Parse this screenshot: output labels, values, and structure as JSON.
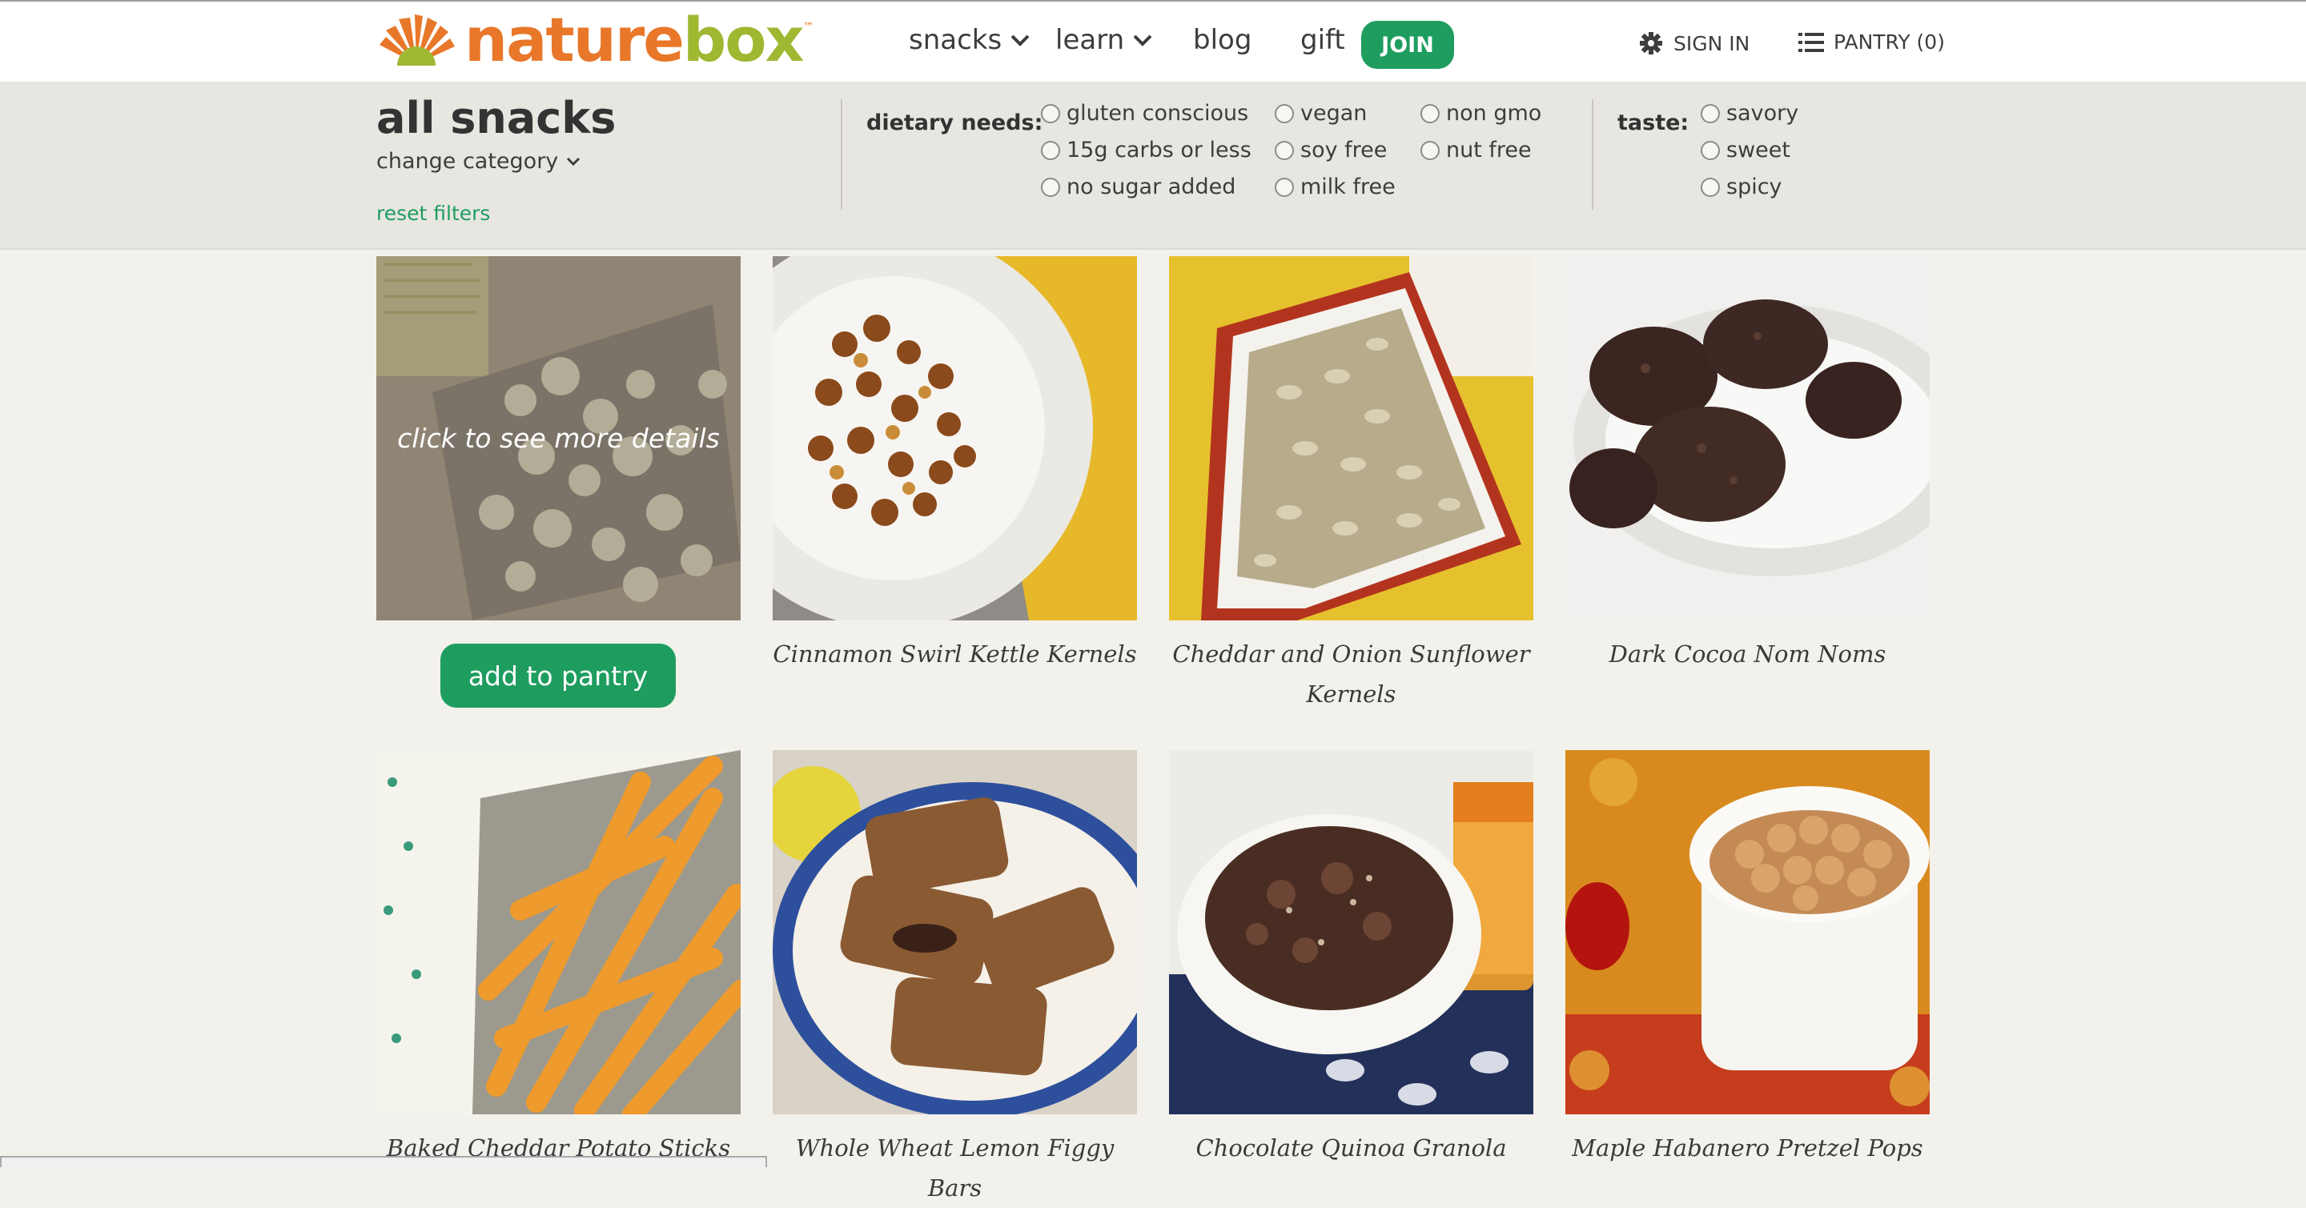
{
  "brand": {
    "word1": "nature",
    "word2": "box",
    "tm": "™"
  },
  "nav": {
    "snacks": "snacks",
    "learn": "learn",
    "blog": "blog",
    "gift": "gift",
    "join": "JOIN",
    "signin": "SIGN IN",
    "pantry": "PANTRY (0)"
  },
  "filters": {
    "category_title": "all snacks",
    "change_category": "change category",
    "reset": "reset filters",
    "dietary_label": "dietary needs:",
    "dietary": {
      "gluten_conscious": "gluten conscious",
      "carbs": "15g carbs or less",
      "no_sugar": "no sugar added",
      "vegan": "vegan",
      "soy_free": "soy free",
      "milk_free": "milk free",
      "non_gmo": "non gmo",
      "nut_free": "nut free"
    },
    "taste_label": "taste:",
    "taste": {
      "savory": "savory",
      "sweet": "sweet",
      "spicy": "spicy"
    }
  },
  "products": {
    "p1": {
      "overlay": "click to see more details",
      "button": "add to pantry"
    },
    "p2": {
      "name": "Cinnamon Swirl Kettle Kernels"
    },
    "p3": {
      "name": "Cheddar and Onion Sunflower Kernels"
    },
    "p4": {
      "name": "Dark Cocoa Nom Noms"
    },
    "p5": {
      "name": "Baked Cheddar Potato Sticks"
    },
    "p6": {
      "name": "Whole Wheat Lemon Figgy Bars"
    },
    "p7": {
      "name": "Chocolate Quinoa Granola"
    },
    "p8": {
      "name": "Maple Habanero Pretzel Pops"
    }
  },
  "colors": {
    "accent_green": "#1e9d5f",
    "brand_orange": "#e8772a",
    "brand_lime": "#9fb832"
  },
  "icons": {
    "signin": "gear-icon",
    "pantry": "list-icon",
    "dropdown": "chevron-down-icon"
  }
}
